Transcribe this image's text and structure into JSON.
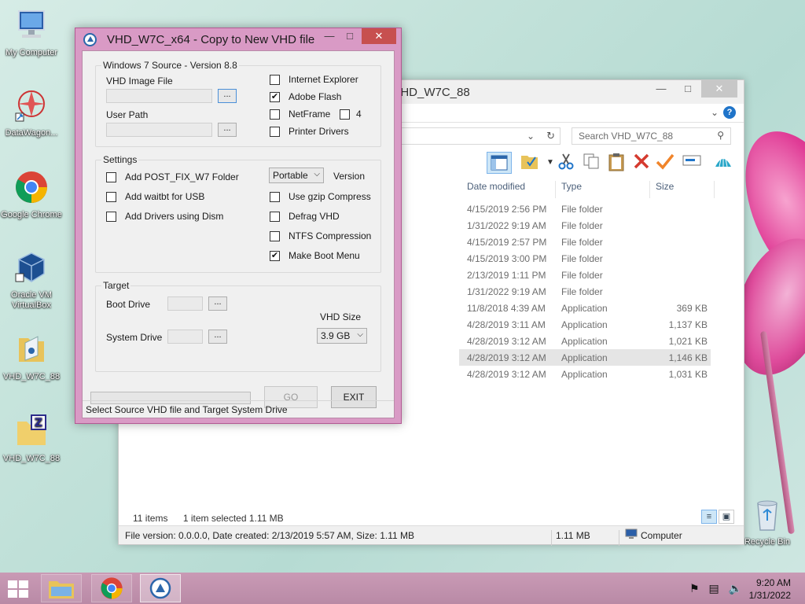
{
  "desktop": {
    "icons": [
      {
        "label": "My Computer"
      },
      {
        "label": "DataWagon..."
      },
      {
        "label": "Google Chrome"
      },
      {
        "label": "Oracle VM VirtualBox"
      },
      {
        "label": "VHD_W7C_88"
      },
      {
        "label": "VHD_W7C_88"
      },
      {
        "label": "Recycle Bin"
      }
    ]
  },
  "explorer": {
    "title": "VHD_W7C_88",
    "search_placeholder": "Search VHD_W7C_88",
    "columns": {
      "date": "Date modified",
      "type": "Type",
      "size": "Size"
    },
    "rows": [
      {
        "date": "4/15/2019 2:56 PM",
        "type": "File folder",
        "size": ""
      },
      {
        "date": "1/31/2022 9:19 AM",
        "type": "File folder",
        "size": ""
      },
      {
        "date": "4/15/2019 2:57 PM",
        "type": "File folder",
        "size": ""
      },
      {
        "date": "4/15/2019 3:00 PM",
        "type": "File folder",
        "size": ""
      },
      {
        "date": "2/13/2019 1:11 PM",
        "type": "File folder",
        "size": ""
      },
      {
        "date": "1/31/2022 9:19 AM",
        "type": "File folder",
        "size": ""
      },
      {
        "date": "11/8/2018 4:39 AM",
        "type": "Application",
        "size": "369 KB"
      },
      {
        "date": "4/28/2019 3:11 AM",
        "type": "Application",
        "size": "1,137 KB"
      },
      {
        "date": "4/28/2019 3:12 AM",
        "type": "Application",
        "size": "1,021 KB"
      },
      {
        "date": "4/28/2019 3:12 AM",
        "type": "Application",
        "size": "1,146 KB"
      },
      {
        "date": "4/28/2019 3:12 AM",
        "type": "Application",
        "size": "1,031 KB"
      }
    ],
    "item_count": "11 items",
    "selection": "1 item selected  1.11 MB",
    "statusbar": {
      "info": "File version: 0.0.0.0, Date created: 2/13/2019 5:57 AM, Size: 1.11 MB",
      "size": "1.11 MB",
      "location": "Computer"
    }
  },
  "dialog": {
    "title": "VHD_W7C_x64 - Copy to New VHD file",
    "source_group": "Windows 7 Source - Version 8.8",
    "vhd_image_file_label": "VHD Image File",
    "user_path_label": "User Path",
    "browse_label": "...",
    "checks_source": [
      {
        "label": "Internet Explorer",
        "checked": false
      },
      {
        "label": "Adobe Flash",
        "checked": true
      },
      {
        "label": "NetFrame",
        "checked": false
      },
      {
        "label": "Printer Drivers",
        "checked": false
      }
    ],
    "netframe_extra": {
      "label": "4",
      "checked": false
    },
    "settings_group": "Settings",
    "checks_settings_left": [
      {
        "label": "Add POST_FIX_W7  Folder",
        "checked": false
      },
      {
        "label": "Add waitbt for USB",
        "checked": false
      },
      {
        "label": "Add Drivers using Dism",
        "checked": false
      }
    ],
    "version_select": "Portable",
    "version_label": "Version",
    "checks_settings_right": [
      {
        "label": "Use gzip Compress",
        "checked": false
      },
      {
        "label": "Defrag VHD",
        "checked": false
      },
      {
        "label": "NTFS Compression",
        "checked": false
      },
      {
        "label": "Make Boot Menu",
        "checked": true
      }
    ],
    "target_group": "Target",
    "boot_drive_label": "Boot Drive",
    "system_drive_label": "System Drive",
    "vhd_size_label": "VHD Size",
    "vhd_size_value": "3.9 GB",
    "go_label": "GO",
    "exit_label": "EXIT",
    "progress": 0,
    "status": "Select Source VHD file and Target System Drive"
  },
  "taskbar": {
    "time": "9:20 AM",
    "date": "1/31/2022"
  },
  "colors": {
    "dialog_frame": "#d99ac5",
    "taskbar": "#c99ab5",
    "accent_blue": "#1f74c9"
  }
}
